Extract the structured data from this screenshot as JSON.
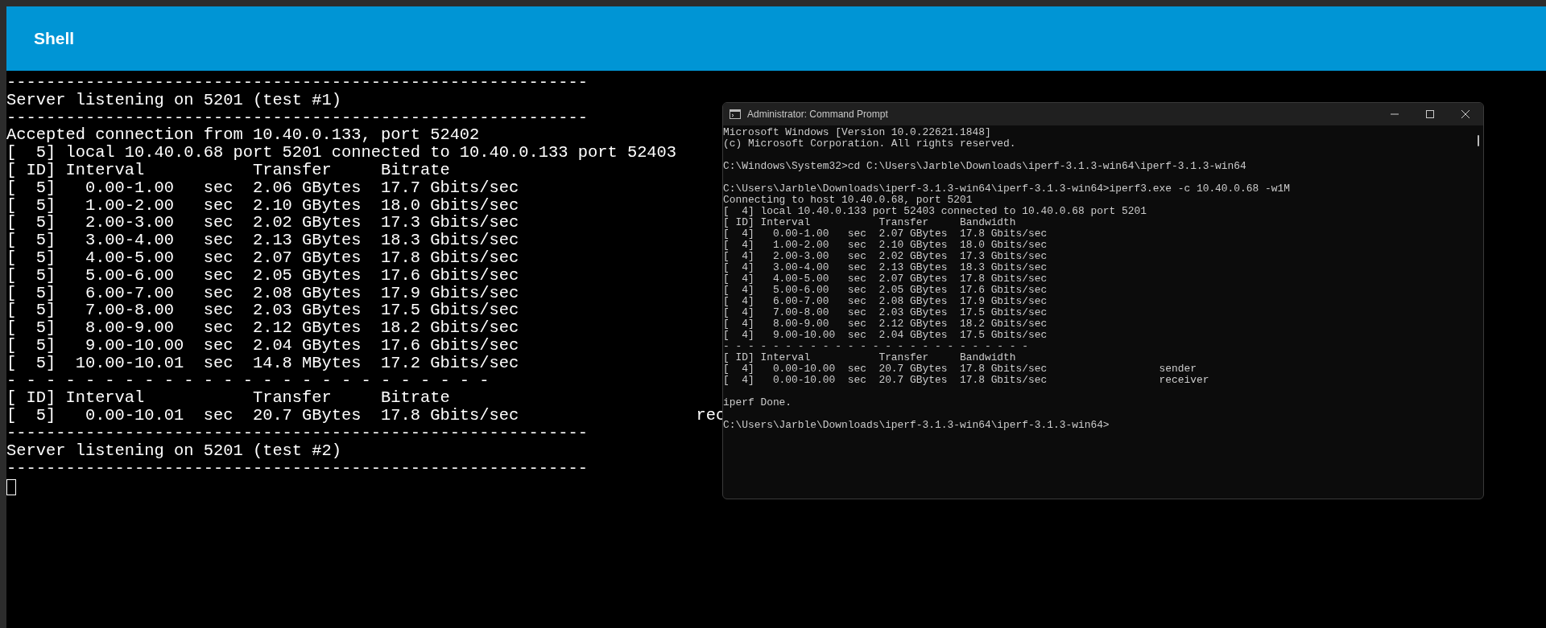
{
  "app_bar": {
    "title": "Shell"
  },
  "terminal": {
    "lines": [
      "-----------------------------------------------------------",
      "Server listening on 5201 (test #1)",
      "-----------------------------------------------------------",
      "Accepted connection from 10.40.0.133, port 52402",
      "[  5] local 10.40.0.68 port 5201 connected to 10.40.0.133 port 52403",
      "[ ID] Interval           Transfer     Bitrate",
      "[  5]   0.00-1.00   sec  2.06 GBytes  17.7 Gbits/sec",
      "[  5]   1.00-2.00   sec  2.10 GBytes  18.0 Gbits/sec",
      "[  5]   2.00-3.00   sec  2.02 GBytes  17.3 Gbits/sec",
      "[  5]   3.00-4.00   sec  2.13 GBytes  18.3 Gbits/sec",
      "[  5]   4.00-5.00   sec  2.07 GBytes  17.8 Gbits/sec",
      "[  5]   5.00-6.00   sec  2.05 GBytes  17.6 Gbits/sec",
      "[  5]   6.00-7.00   sec  2.08 GBytes  17.9 Gbits/sec",
      "[  5]   7.00-8.00   sec  2.03 GBytes  17.5 Gbits/sec",
      "[  5]   8.00-9.00   sec  2.12 GBytes  18.2 Gbits/sec",
      "[  5]   9.00-10.00  sec  2.04 GBytes  17.6 Gbits/sec",
      "[  5]  10.00-10.01  sec  14.8 MBytes  17.2 Gbits/sec",
      "- - - - - - - - - - - - - - - - - - - - - - - - -",
      "[ ID] Interval           Transfer     Bitrate",
      "[  5]   0.00-10.01  sec  20.7 GBytes  17.8 Gbits/sec                  rec",
      "-----------------------------------------------------------",
      "Server listening on 5201 (test #2)",
      "-----------------------------------------------------------"
    ]
  },
  "cmd_window": {
    "title": "Administrator: Command Prompt",
    "blocks": [
      [
        "Microsoft Windows [Version 10.0.22621.1848]",
        "(c) Microsoft Corporation. All rights reserved."
      ],
      [
        "C:\\Windows\\System32>cd C:\\Users\\Jarble\\Downloads\\iperf-3.1.3-win64\\iperf-3.1.3-win64"
      ],
      [
        "C:\\Users\\Jarble\\Downloads\\iperf-3.1.3-win64\\iperf-3.1.3-win64>iperf3.exe -c 10.40.0.68 -w1M",
        "Connecting to host 10.40.0.68, port 5201",
        "[  4] local 10.40.0.133 port 52403 connected to 10.40.0.68 port 5201",
        "[ ID] Interval           Transfer     Bandwidth",
        "[  4]   0.00-1.00   sec  2.07 GBytes  17.8 Gbits/sec",
        "[  4]   1.00-2.00   sec  2.10 GBytes  18.0 Gbits/sec",
        "[  4]   2.00-3.00   sec  2.02 GBytes  17.3 Gbits/sec",
        "[  4]   3.00-4.00   sec  2.13 GBytes  18.3 Gbits/sec",
        "[  4]   4.00-5.00   sec  2.07 GBytes  17.8 Gbits/sec",
        "[  4]   5.00-6.00   sec  2.05 GBytes  17.6 Gbits/sec",
        "[  4]   6.00-7.00   sec  2.08 GBytes  17.9 Gbits/sec",
        "[  4]   7.00-8.00   sec  2.03 GBytes  17.5 Gbits/sec",
        "[  4]   8.00-9.00   sec  2.12 GBytes  18.2 Gbits/sec",
        "[  4]   9.00-10.00  sec  2.04 GBytes  17.5 Gbits/sec",
        "- - - - - - - - - - - - - - - - - - - - - - - - -",
        "[ ID] Interval           Transfer     Bandwidth",
        "[  4]   0.00-10.00  sec  20.7 GBytes  17.8 Gbits/sec                  sender",
        "[  4]   0.00-10.00  sec  20.7 GBytes  17.8 Gbits/sec                  receiver"
      ],
      [
        "iperf Done."
      ],
      [
        "C:\\Users\\Jarble\\Downloads\\iperf-3.1.3-win64\\iperf-3.1.3-win64>"
      ]
    ]
  }
}
